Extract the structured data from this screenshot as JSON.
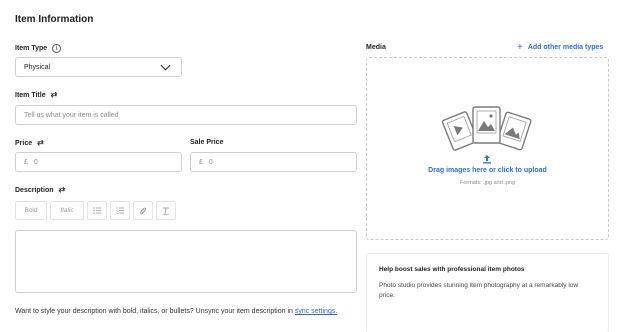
{
  "section_title": "Item Information",
  "item_type": {
    "label": "Item Type",
    "info_icon": "info-icon",
    "selected": "Physical"
  },
  "item_title": {
    "label": "Item Title",
    "placeholder": "Tell us what your item is called"
  },
  "price": {
    "label": "Price",
    "currency": "£",
    "value": "0"
  },
  "sale_price": {
    "label": "Sale Price",
    "currency": "£",
    "value": "0"
  },
  "description": {
    "label": "Description",
    "toolbar": {
      "bold": "Bold",
      "italic": "Italic",
      "bullet_icon": "bullet-list-icon",
      "numbered_icon": "numbered-list-icon",
      "link_icon": "link-icon",
      "clear_icon": "clear-format-icon"
    },
    "hint_text": "Want to style your description with bold, italics, or bullets? Unsync your item description in ",
    "hint_link": "sync settings."
  },
  "media": {
    "label": "Media",
    "add_link": "Add other media types",
    "drop_text": "Drag images here or click to upload",
    "formats": "Formats: .jpg and .png"
  },
  "promo": {
    "title": "Help boost sales with professional item photos",
    "body": "Photo studio provides stunning item photography at a remarkably low price."
  },
  "colors": {
    "accent": "#2d6ce0",
    "border": "#cfcfcf"
  }
}
